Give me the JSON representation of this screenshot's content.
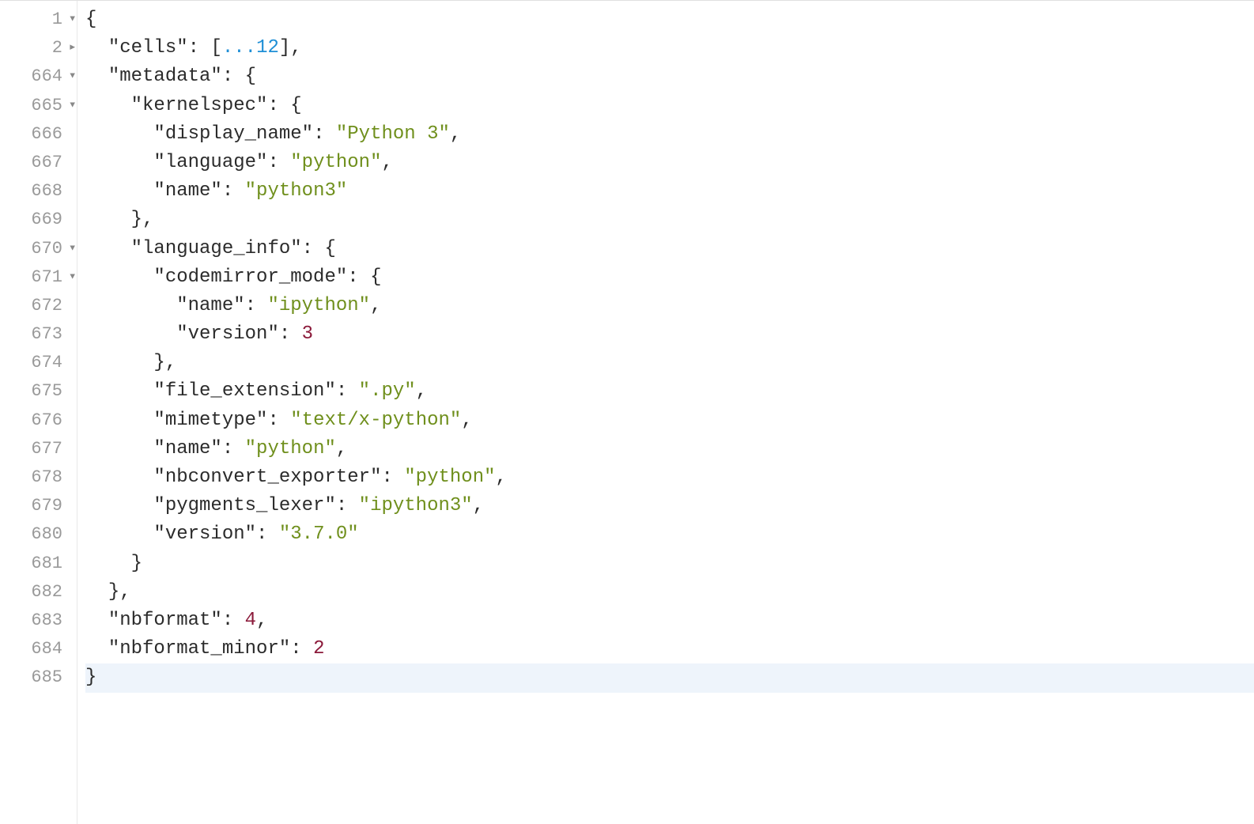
{
  "lines": [
    {
      "num": "1",
      "fold": "open",
      "indent": 0,
      "tokens": [
        {
          "t": "punc",
          "v": "{"
        }
      ]
    },
    {
      "num": "2",
      "fold": "closed",
      "indent": 1,
      "tokens": [
        {
          "t": "key",
          "v": "\"cells\""
        },
        {
          "t": "punc",
          "v": ": "
        },
        {
          "t": "punc",
          "v": "["
        },
        {
          "t": "fold",
          "v": "...12"
        },
        {
          "t": "punc",
          "v": "]"
        },
        {
          "t": "punc",
          "v": ","
        }
      ]
    },
    {
      "num": "664",
      "fold": "open",
      "indent": 1,
      "tokens": [
        {
          "t": "key",
          "v": "\"metadata\""
        },
        {
          "t": "punc",
          "v": ": "
        },
        {
          "t": "punc",
          "v": "{"
        }
      ]
    },
    {
      "num": "665",
      "fold": "open",
      "indent": 2,
      "tokens": [
        {
          "t": "key",
          "v": "\"kernelspec\""
        },
        {
          "t": "punc",
          "v": ": "
        },
        {
          "t": "punc",
          "v": "{"
        }
      ]
    },
    {
      "num": "666",
      "fold": null,
      "indent": 3,
      "tokens": [
        {
          "t": "key",
          "v": "\"display_name\""
        },
        {
          "t": "punc",
          "v": ": "
        },
        {
          "t": "str",
          "v": "\"Python 3\""
        },
        {
          "t": "punc",
          "v": ","
        }
      ]
    },
    {
      "num": "667",
      "fold": null,
      "indent": 3,
      "tokens": [
        {
          "t": "key",
          "v": "\"language\""
        },
        {
          "t": "punc",
          "v": ": "
        },
        {
          "t": "str",
          "v": "\"python\""
        },
        {
          "t": "punc",
          "v": ","
        }
      ]
    },
    {
      "num": "668",
      "fold": null,
      "indent": 3,
      "tokens": [
        {
          "t": "key",
          "v": "\"name\""
        },
        {
          "t": "punc",
          "v": ": "
        },
        {
          "t": "str",
          "v": "\"python3\""
        }
      ]
    },
    {
      "num": "669",
      "fold": null,
      "indent": 2,
      "tokens": [
        {
          "t": "punc",
          "v": "}"
        },
        {
          "t": "punc",
          "v": ","
        }
      ]
    },
    {
      "num": "670",
      "fold": "open",
      "indent": 2,
      "tokens": [
        {
          "t": "key",
          "v": "\"language_info\""
        },
        {
          "t": "punc",
          "v": ": "
        },
        {
          "t": "punc",
          "v": "{"
        }
      ]
    },
    {
      "num": "671",
      "fold": "open",
      "indent": 3,
      "tokens": [
        {
          "t": "key",
          "v": "\"codemirror_mode\""
        },
        {
          "t": "punc",
          "v": ": "
        },
        {
          "t": "punc",
          "v": "{"
        }
      ]
    },
    {
      "num": "672",
      "fold": null,
      "indent": 4,
      "tokens": [
        {
          "t": "key",
          "v": "\"name\""
        },
        {
          "t": "punc",
          "v": ": "
        },
        {
          "t": "str",
          "v": "\"ipython\""
        },
        {
          "t": "punc",
          "v": ","
        }
      ]
    },
    {
      "num": "673",
      "fold": null,
      "indent": 4,
      "tokens": [
        {
          "t": "key",
          "v": "\"version\""
        },
        {
          "t": "punc",
          "v": ": "
        },
        {
          "t": "num",
          "v": "3"
        }
      ]
    },
    {
      "num": "674",
      "fold": null,
      "indent": 3,
      "tokens": [
        {
          "t": "punc",
          "v": "}"
        },
        {
          "t": "punc",
          "v": ","
        }
      ]
    },
    {
      "num": "675",
      "fold": null,
      "indent": 3,
      "tokens": [
        {
          "t": "key",
          "v": "\"file_extension\""
        },
        {
          "t": "punc",
          "v": ": "
        },
        {
          "t": "str",
          "v": "\".py\""
        },
        {
          "t": "punc",
          "v": ","
        }
      ]
    },
    {
      "num": "676",
      "fold": null,
      "indent": 3,
      "tokens": [
        {
          "t": "key",
          "v": "\"mimetype\""
        },
        {
          "t": "punc",
          "v": ": "
        },
        {
          "t": "str",
          "v": "\"text/x-python\""
        },
        {
          "t": "punc",
          "v": ","
        }
      ]
    },
    {
      "num": "677",
      "fold": null,
      "indent": 3,
      "tokens": [
        {
          "t": "key",
          "v": "\"name\""
        },
        {
          "t": "punc",
          "v": ": "
        },
        {
          "t": "str",
          "v": "\"python\""
        },
        {
          "t": "punc",
          "v": ","
        }
      ]
    },
    {
      "num": "678",
      "fold": null,
      "indent": 3,
      "tokens": [
        {
          "t": "key",
          "v": "\"nbconvert_exporter\""
        },
        {
          "t": "punc",
          "v": ": "
        },
        {
          "t": "str",
          "v": "\"python\""
        },
        {
          "t": "punc",
          "v": ","
        }
      ]
    },
    {
      "num": "679",
      "fold": null,
      "indent": 3,
      "tokens": [
        {
          "t": "key",
          "v": "\"pygments_lexer\""
        },
        {
          "t": "punc",
          "v": ": "
        },
        {
          "t": "str",
          "v": "\"ipython3\""
        },
        {
          "t": "punc",
          "v": ","
        }
      ]
    },
    {
      "num": "680",
      "fold": null,
      "indent": 3,
      "tokens": [
        {
          "t": "key",
          "v": "\"version\""
        },
        {
          "t": "punc",
          "v": ": "
        },
        {
          "t": "str",
          "v": "\"3.7.0\""
        }
      ]
    },
    {
      "num": "681",
      "fold": null,
      "indent": 2,
      "tokens": [
        {
          "t": "punc",
          "v": "}"
        }
      ]
    },
    {
      "num": "682",
      "fold": null,
      "indent": 1,
      "tokens": [
        {
          "t": "punc",
          "v": "}"
        },
        {
          "t": "punc",
          "v": ","
        }
      ]
    },
    {
      "num": "683",
      "fold": null,
      "indent": 1,
      "tokens": [
        {
          "t": "key",
          "v": "\"nbformat\""
        },
        {
          "t": "punc",
          "v": ": "
        },
        {
          "t": "num",
          "v": "4"
        },
        {
          "t": "punc",
          "v": ","
        }
      ]
    },
    {
      "num": "684",
      "fold": null,
      "indent": 1,
      "tokens": [
        {
          "t": "key",
          "v": "\"nbformat_minor\""
        },
        {
          "t": "punc",
          "v": ": "
        },
        {
          "t": "num",
          "v": "2"
        }
      ]
    },
    {
      "num": "685",
      "fold": null,
      "indent": 0,
      "tokens": [
        {
          "t": "punc",
          "v": "}"
        }
      ],
      "highlight": true
    }
  ],
  "fold_glyphs": {
    "open": "▼",
    "closed": "▶"
  },
  "indent_unit": "  "
}
